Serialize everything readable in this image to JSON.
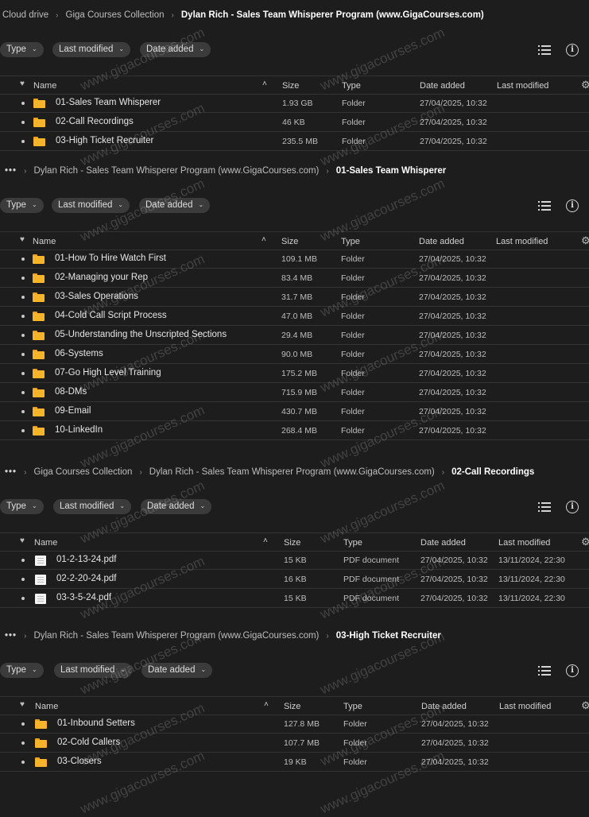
{
  "filters": {
    "type": "Type",
    "last_modified": "Last modified",
    "date_added": "Date added"
  },
  "columns": {
    "name": "Name",
    "size": "Size",
    "type": "Type",
    "date_added": "Date added",
    "last_modified": "Last modified"
  },
  "watermark": "www.gigacourses.com",
  "panels": [
    {
      "breadcrumb": [
        "Cloud drive",
        "Giga Courses Collection",
        "Dylan Rich - Sales Team Whisperer Program (www.GigaCourses.com)"
      ],
      "rows": [
        {
          "name": "01-Sales Team Whisperer",
          "size": "1.93 GB",
          "type": "Folder",
          "date_added": "27/04/2025, 10:32",
          "last_modified": "",
          "icon": "folder-icon"
        },
        {
          "name": "02-Call Recordings",
          "size": "46 KB",
          "type": "Folder",
          "date_added": "27/04/2025, 10:32",
          "last_modified": "",
          "icon": "folder-icon"
        },
        {
          "name": "03-High Ticket Recruiter",
          "size": "235.5 MB",
          "type": "Folder",
          "date_added": "27/04/2025, 10:32",
          "last_modified": "",
          "icon": "folder-icon"
        }
      ]
    },
    {
      "breadcrumb": [
        "Dylan Rich - Sales Team Whisperer Program (www.GigaCourses.com)",
        "01-Sales Team Whisperer"
      ],
      "rows": [
        {
          "name": "01-How To Hire Watch First",
          "size": "109.1 MB",
          "type": "Folder",
          "date_added": "27/04/2025, 10:32",
          "last_modified": "",
          "icon": "folder-icon"
        },
        {
          "name": "02-Managing your Rep",
          "size": "83.4 MB",
          "type": "Folder",
          "date_added": "27/04/2025, 10:32",
          "last_modified": "",
          "icon": "folder-icon"
        },
        {
          "name": "03-Sales Operations",
          "size": "31.7 MB",
          "type": "Folder",
          "date_added": "27/04/2025, 10:32",
          "last_modified": "",
          "icon": "folder-icon"
        },
        {
          "name": "04-Cold Call Script Process",
          "size": "47.0 MB",
          "type": "Folder",
          "date_added": "27/04/2025, 10:32",
          "last_modified": "",
          "icon": "folder-icon"
        },
        {
          "name": "05-Understanding the Unscripted Sections",
          "size": "29.4 MB",
          "type": "Folder",
          "date_added": "27/04/2025, 10:32",
          "last_modified": "",
          "icon": "folder-icon"
        },
        {
          "name": "06-Systems",
          "size": "90.0 MB",
          "type": "Folder",
          "date_added": "27/04/2025, 10:32",
          "last_modified": "",
          "icon": "folder-icon"
        },
        {
          "name": "07-Go High Level Training",
          "size": "175.2 MB",
          "type": "Folder",
          "date_added": "27/04/2025, 10:32",
          "last_modified": "",
          "icon": "folder-icon"
        },
        {
          "name": "08-DMs",
          "size": "715.9 MB",
          "type": "Folder",
          "date_added": "27/04/2025, 10:32",
          "last_modified": "",
          "icon": "folder-icon"
        },
        {
          "name": "09-Email",
          "size": "430.7 MB",
          "type": "Folder",
          "date_added": "27/04/2025, 10:32",
          "last_modified": "",
          "icon": "folder-icon"
        },
        {
          "name": "10-LinkedIn",
          "size": "268.4 MB",
          "type": "Folder",
          "date_added": "27/04/2025, 10:32",
          "last_modified": "",
          "icon": "folder-icon"
        }
      ]
    },
    {
      "breadcrumb": [
        "Giga Courses Collection",
        "Dylan Rich - Sales Team Whisperer Program (www.GigaCourses.com)",
        "02-Call Recordings"
      ],
      "rows": [
        {
          "name": "01-2-13-24.pdf",
          "size": "15 KB",
          "type": "PDF document",
          "date_added": "27/04/2025, 10:32",
          "last_modified": "13/11/2024, 22:30",
          "icon": "pdf-file-icon"
        },
        {
          "name": "02-2-20-24.pdf",
          "size": "16 KB",
          "type": "PDF document",
          "date_added": "27/04/2025, 10:32",
          "last_modified": "13/11/2024, 22:30",
          "icon": "pdf-file-icon"
        },
        {
          "name": "03-3-5-24.pdf",
          "size": "15 KB",
          "type": "PDF document",
          "date_added": "27/04/2025, 10:32",
          "last_modified": "13/11/2024, 22:30",
          "icon": "pdf-file-icon"
        }
      ]
    },
    {
      "breadcrumb": [
        "Dylan Rich - Sales Team Whisperer Program (www.GigaCourses.com)",
        "03-High Ticket Recruiter"
      ],
      "rows": [
        {
          "name": "01-Inbound Setters",
          "size": "127.8 MB",
          "type": "Folder",
          "date_added": "27/04/2025, 10:32",
          "last_modified": "",
          "icon": "folder-icon"
        },
        {
          "name": "02-Cold Callers",
          "size": "107.7 MB",
          "type": "Folder",
          "date_added": "27/04/2025, 10:32",
          "last_modified": "",
          "icon": "folder-icon"
        },
        {
          "name": "03-Closers",
          "size": "19 KB",
          "type": "Folder",
          "date_added": "27/04/2025, 10:32",
          "last_modified": "",
          "icon": "folder-icon"
        }
      ]
    }
  ]
}
